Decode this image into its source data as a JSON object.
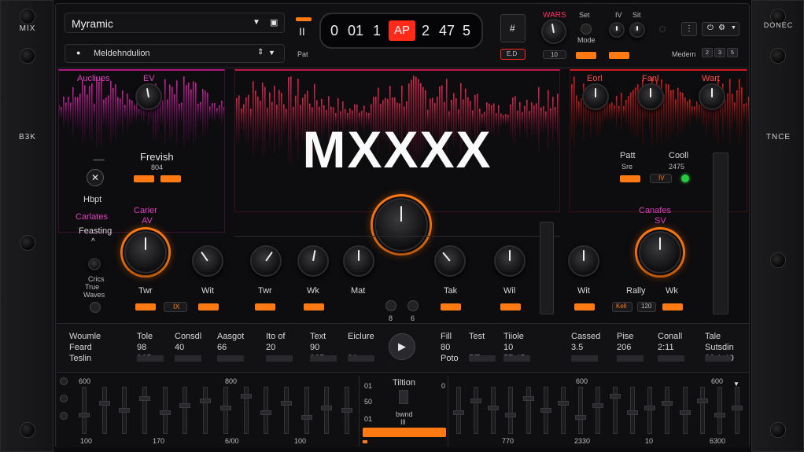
{
  "rack": {
    "left_top_label": "MIX",
    "left_side_label": "B3K",
    "right_top_label": "DONEC",
    "right_side_label": "TNCE"
  },
  "header": {
    "preset_name": "Myramic",
    "sub_preset": "Meldehndulion",
    "pause_label": "II",
    "pat_label": "Pat",
    "time_display": {
      "seg1": "0",
      "seg2": "01",
      "seg3": "1",
      "badge": "AP",
      "seg4": "2",
      "seg5": "47",
      "seg6": "5"
    },
    "hash_label": "#",
    "edit_label": "E.D",
    "knob_group_label": "WARS",
    "set_label": "Set",
    "mode_label": "Mode",
    "iv_label": "IV",
    "sit_label": "Sit",
    "small_a": "10",
    "modern_label": "Medern",
    "page_buttons": [
      "2",
      "3",
      "5"
    ]
  },
  "left_panel": {
    "title": "Aucliues",
    "knob_label": "EV",
    "name": "Frevish",
    "sub": "804",
    "hbpt_label": "Hbpt",
    "section_label": "Carlates",
    "feasting_label": "Feasting",
    "carier_label": "Carier",
    "av_label": "AV",
    "side_a": "Crics",
    "side_b": "True",
    "side_c": "Waves",
    "twr_label": "Twr",
    "wit_label": "Wit",
    "mid_badge": "IX"
  },
  "center": {
    "title": "MXXXX",
    "knobs": [
      {
        "label": "Twr"
      },
      {
        "label": "Wk"
      },
      {
        "label": "Mat"
      },
      {
        "label": "Tak"
      },
      {
        "label": "Wil"
      }
    ],
    "small_a": "8",
    "small_b": "6"
  },
  "right_panel": {
    "k1": "Eorl",
    "k2": "Fanl",
    "k3": "Wart",
    "patt_label": "Patt",
    "sre_label": "Sre",
    "cool_label": "Cooll",
    "cool_sub": "2475",
    "iv_badge": "IV",
    "section_label": "Canafes",
    "sv_label": "SV",
    "wit_label": "Wit",
    "rally_label": "Rally",
    "wk_label": "Wk",
    "badge1": "Kell",
    "badge2": "120"
  },
  "info_strip": {
    "cols": [
      {
        "h": "Woumle",
        "a": "Feard",
        "b": "Teslin"
      },
      {
        "h": "Tole",
        "a": "98",
        "b": "865"
      },
      {
        "h": "Consdl",
        "a": "40",
        "b": ""
      },
      {
        "h": "Aasgot",
        "a": "66",
        "b": ""
      },
      {
        "h": "Ito of",
        "a": "20",
        "b": ""
      },
      {
        "h": "Text",
        "a": "90",
        "b": "365"
      },
      {
        "h": "Eiclure",
        "a": "",
        "b": "80"
      },
      {
        "h": "Fill",
        "a": "80",
        "b": "Poto"
      },
      {
        "h": "Test",
        "a": "",
        "b": "PT"
      },
      {
        "h": "Tiiole",
        "a": "10",
        "b": "57.45"
      },
      {
        "h": "Cassed",
        "a": "3.5",
        "b": ""
      },
      {
        "h": "Pise",
        "a": "206",
        "b": ""
      },
      {
        "h": "Conall",
        "a": "2:11",
        "b": ""
      },
      {
        "h": "Tale",
        "a": "Sutsdin",
        "b": "32.1 40"
      }
    ]
  },
  "bottom": {
    "top_left": "600",
    "top_mid": "800",
    "tiltion": "Tiltion",
    "zero_a": "0",
    "zero_b": "0",
    "nums_small": [
      "01",
      "50",
      "01"
    ],
    "bwnd": "bwnd",
    "bwnd_b": "Ill",
    "top_right_a": "600",
    "top_right_b": "600",
    "bottom_labels": [
      "100",
      "170",
      "6/00",
      "100",
      "770",
      "2330",
      "10",
      "6300"
    ],
    "left_fader_levels": [
      0.45,
      0.7,
      0.55,
      0.8,
      0.5,
      0.65,
      0.75,
      0.6,
      0.85,
      0.5,
      0.7,
      0.4,
      0.6,
      0.55
    ],
    "right_fader_levels": [
      0.5,
      0.75,
      0.6,
      0.45,
      0.8,
      0.55,
      0.7,
      0.4,
      0.65,
      0.85,
      0.5,
      0.6,
      0.7,
      0.5,
      0.75,
      0.45,
      0.6
    ]
  },
  "colors": {
    "accent": "#ff7a12",
    "magenta": "#c0208c",
    "red": "#e01e3a",
    "badge_red": "#ff2a1a"
  }
}
